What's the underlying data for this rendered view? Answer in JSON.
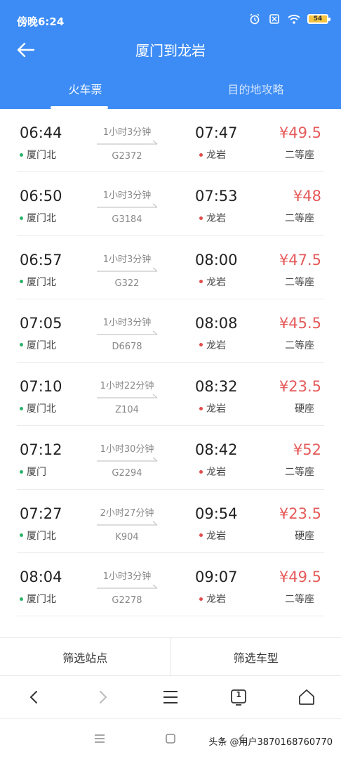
{
  "status_bar": {
    "time": "傍晚6:24",
    "battery": "54"
  },
  "header": {
    "title": "厦门到龙岩"
  },
  "tabs": [
    {
      "label": "火车票",
      "active": true
    },
    {
      "label": "目的地攻略",
      "active": false
    }
  ],
  "trains": [
    {
      "dep_time": "06:44",
      "dep_station": "厦门北",
      "duration": "1小时3分钟",
      "train_no": "G2372",
      "arr_time": "07:47",
      "arr_station": "龙岩",
      "price": "¥49.5",
      "seat": "二等座"
    },
    {
      "dep_time": "06:50",
      "dep_station": "厦门北",
      "duration": "1小时3分钟",
      "train_no": "G3184",
      "arr_time": "07:53",
      "arr_station": "龙岩",
      "price": "¥48",
      "seat": "二等座"
    },
    {
      "dep_time": "06:57",
      "dep_station": "厦门北",
      "duration": "1小时3分钟",
      "train_no": "G322",
      "arr_time": "08:00",
      "arr_station": "龙岩",
      "price": "¥47.5",
      "seat": "二等座"
    },
    {
      "dep_time": "07:05",
      "dep_station": "厦门北",
      "duration": "1小时3分钟",
      "train_no": "D6678",
      "arr_time": "08:08",
      "arr_station": "龙岩",
      "price": "¥45.5",
      "seat": "二等座"
    },
    {
      "dep_time": "07:10",
      "dep_station": "厦门北",
      "duration": "1小时22分钟",
      "train_no": "Z104",
      "arr_time": "08:32",
      "arr_station": "龙岩",
      "price": "¥23.5",
      "seat": "硬座"
    },
    {
      "dep_time": "07:12",
      "dep_station": "厦门",
      "duration": "1小时30分钟",
      "train_no": "G2294",
      "arr_time": "08:42",
      "arr_station": "龙岩",
      "price": "¥52",
      "seat": "二等座"
    },
    {
      "dep_time": "07:27",
      "dep_station": "厦门北",
      "duration": "2小时27分钟",
      "train_no": "K904",
      "arr_time": "09:54",
      "arr_station": "龙岩",
      "price": "¥23.5",
      "seat": "硬座"
    },
    {
      "dep_time": "08:04",
      "dep_station": "厦门北",
      "duration": "1小时3分钟",
      "train_no": "G2278",
      "arr_time": "09:07",
      "arr_station": "龙岩",
      "price": "¥49.5",
      "seat": "二等座"
    }
  ],
  "filters": {
    "station_label": "筛选站点",
    "train_type_label": "筛选车型"
  },
  "browser_nav": {
    "tab_count": "1"
  },
  "watermark": "头条 @用户3870168760770",
  "colors": {
    "header_bg": "#3d8cf5",
    "price": "#e65a5a",
    "dep_dot": "#2ab36a",
    "arr_dot": "#e24c4c"
  },
  "icons": [
    "back-arrow-icon",
    "alarm-icon",
    "sim-icon",
    "wifi-icon",
    "battery-icon",
    "nav-back-icon",
    "nav-forward-icon",
    "menu-icon",
    "tabs-icon",
    "home-icon"
  ]
}
